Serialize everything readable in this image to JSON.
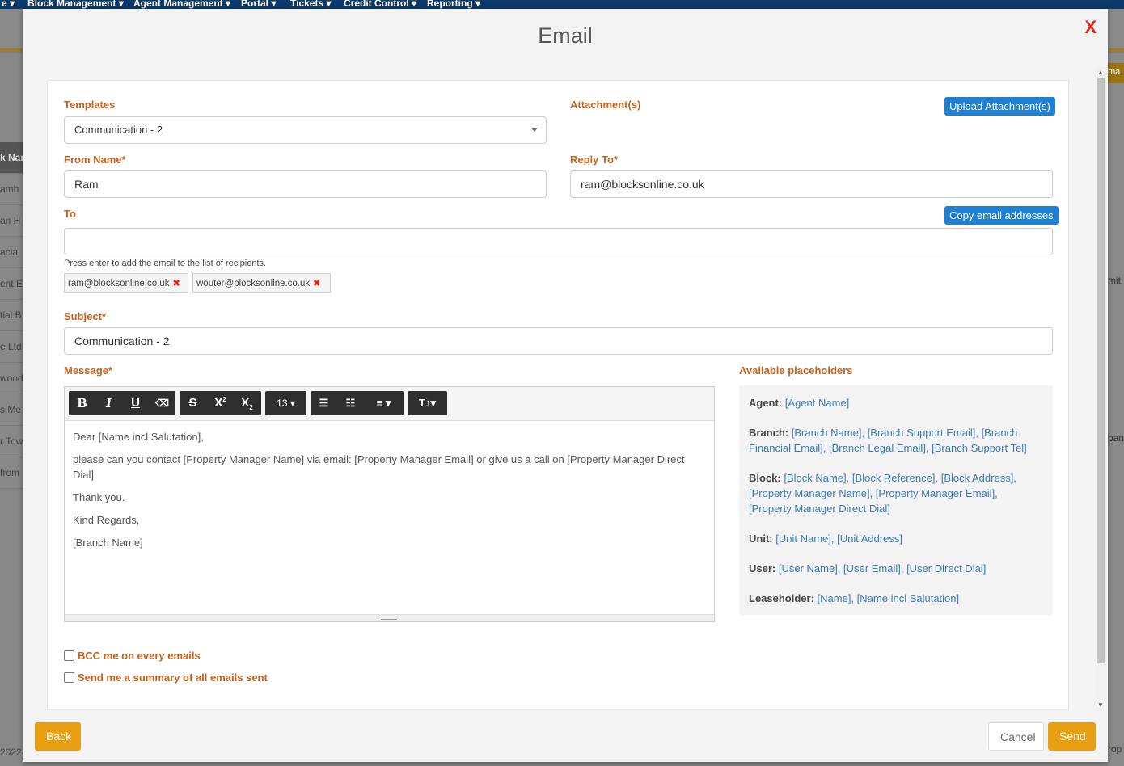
{
  "background": {
    "nav": [
      "e ▾",
      "Block Management ▾",
      "Agent Management ▾",
      "Portal ▾",
      "Tickets ▾",
      "Credit Control ▾",
      "Reporting ▾"
    ],
    "left_rows": [
      "k Nar",
      "amh",
      "an H",
      "acia",
      "ent E",
      "tial B",
      "e Ltd",
      "wood",
      "s Me",
      "r Tow",
      " from"
    ],
    "footer_year": "2022",
    "right_texts": [
      "mit",
      "pan",
      "rop"
    ],
    "right_button": "ma"
  },
  "modal": {
    "title": "Email",
    "close_label": "X"
  },
  "form": {
    "templates_label": "Templates",
    "templates_value": "Communication - 2",
    "attachments_label": "Attachment(s)",
    "upload_button": "Upload Attachment(s)",
    "from_name_label": "From Name",
    "from_name_value": "Ram",
    "reply_to_label": "Reply To",
    "reply_to_value": "ram@blocksonline.co.uk",
    "to_label": "To",
    "copy_button": "Copy email addresses",
    "to_value": "",
    "to_hint": "Press enter to add the email to the list of recipients.",
    "recipients": [
      "ram@blocksonline.co.uk",
      "wouter@blocksonline.co.uk"
    ],
    "subject_label": "Subject",
    "subject_value": "Communication - 2",
    "message_label": "Message",
    "required_mark": "*",
    "remove_mark": "✖"
  },
  "toolbar": {
    "bold": "B",
    "italic": "I",
    "underline": "U",
    "eraser": "⌫",
    "strikethrough": "S",
    "superscript": "X",
    "subscript": "X",
    "font_size": "13 ▾",
    "ul": "☰",
    "ol": "☷",
    "align": "≡ ▾",
    "text_style": "T↕▾"
  },
  "message_body": [
    "Dear [Name incl Salutation],",
    "please can you contact [Property Manager Name] via email: [Property Manager Email] or give us a call on [Property Manager Direct Dial].",
    "Thank you.",
    "Kind Regards,",
    "[Branch Name]"
  ],
  "placeholders": {
    "title": "Available placeholders",
    "groups": [
      {
        "label": "Agent:",
        "items": "[Agent Name]"
      },
      {
        "label": "Branch:",
        "items": "[Branch Name], [Branch Support Email], [Branch Financial Email], [Branch Legal Email], [Branch Support Tel]"
      },
      {
        "label": "Block:",
        "items": "[Block Name], [Block Reference], [Block Address], [Property Manager Name], [Property Manager Email], [Property Manager Direct Dial]"
      },
      {
        "label": "Unit:",
        "items": "[Unit Name], [Unit Address]"
      },
      {
        "label": "User:",
        "items": "[User Name], [User Email], [User Direct Dial]"
      },
      {
        "label": "Leaseholder:",
        "items": "[Name], [Name incl Salutation]"
      }
    ]
  },
  "options": {
    "bcc_label": "BCC me on every emails",
    "bcc_checked": false,
    "summary_label": "Send me a summary of all emails sent",
    "summary_checked": false
  },
  "footer": {
    "back": "Back",
    "cancel": "Cancel",
    "send": "Send"
  },
  "colors": {
    "accent_orange": "#e8a012",
    "label_orange": "#c7621e",
    "button_blue": "#1f7fd1",
    "link_blue": "#3d7ab8",
    "close_red": "#e4211b"
  }
}
